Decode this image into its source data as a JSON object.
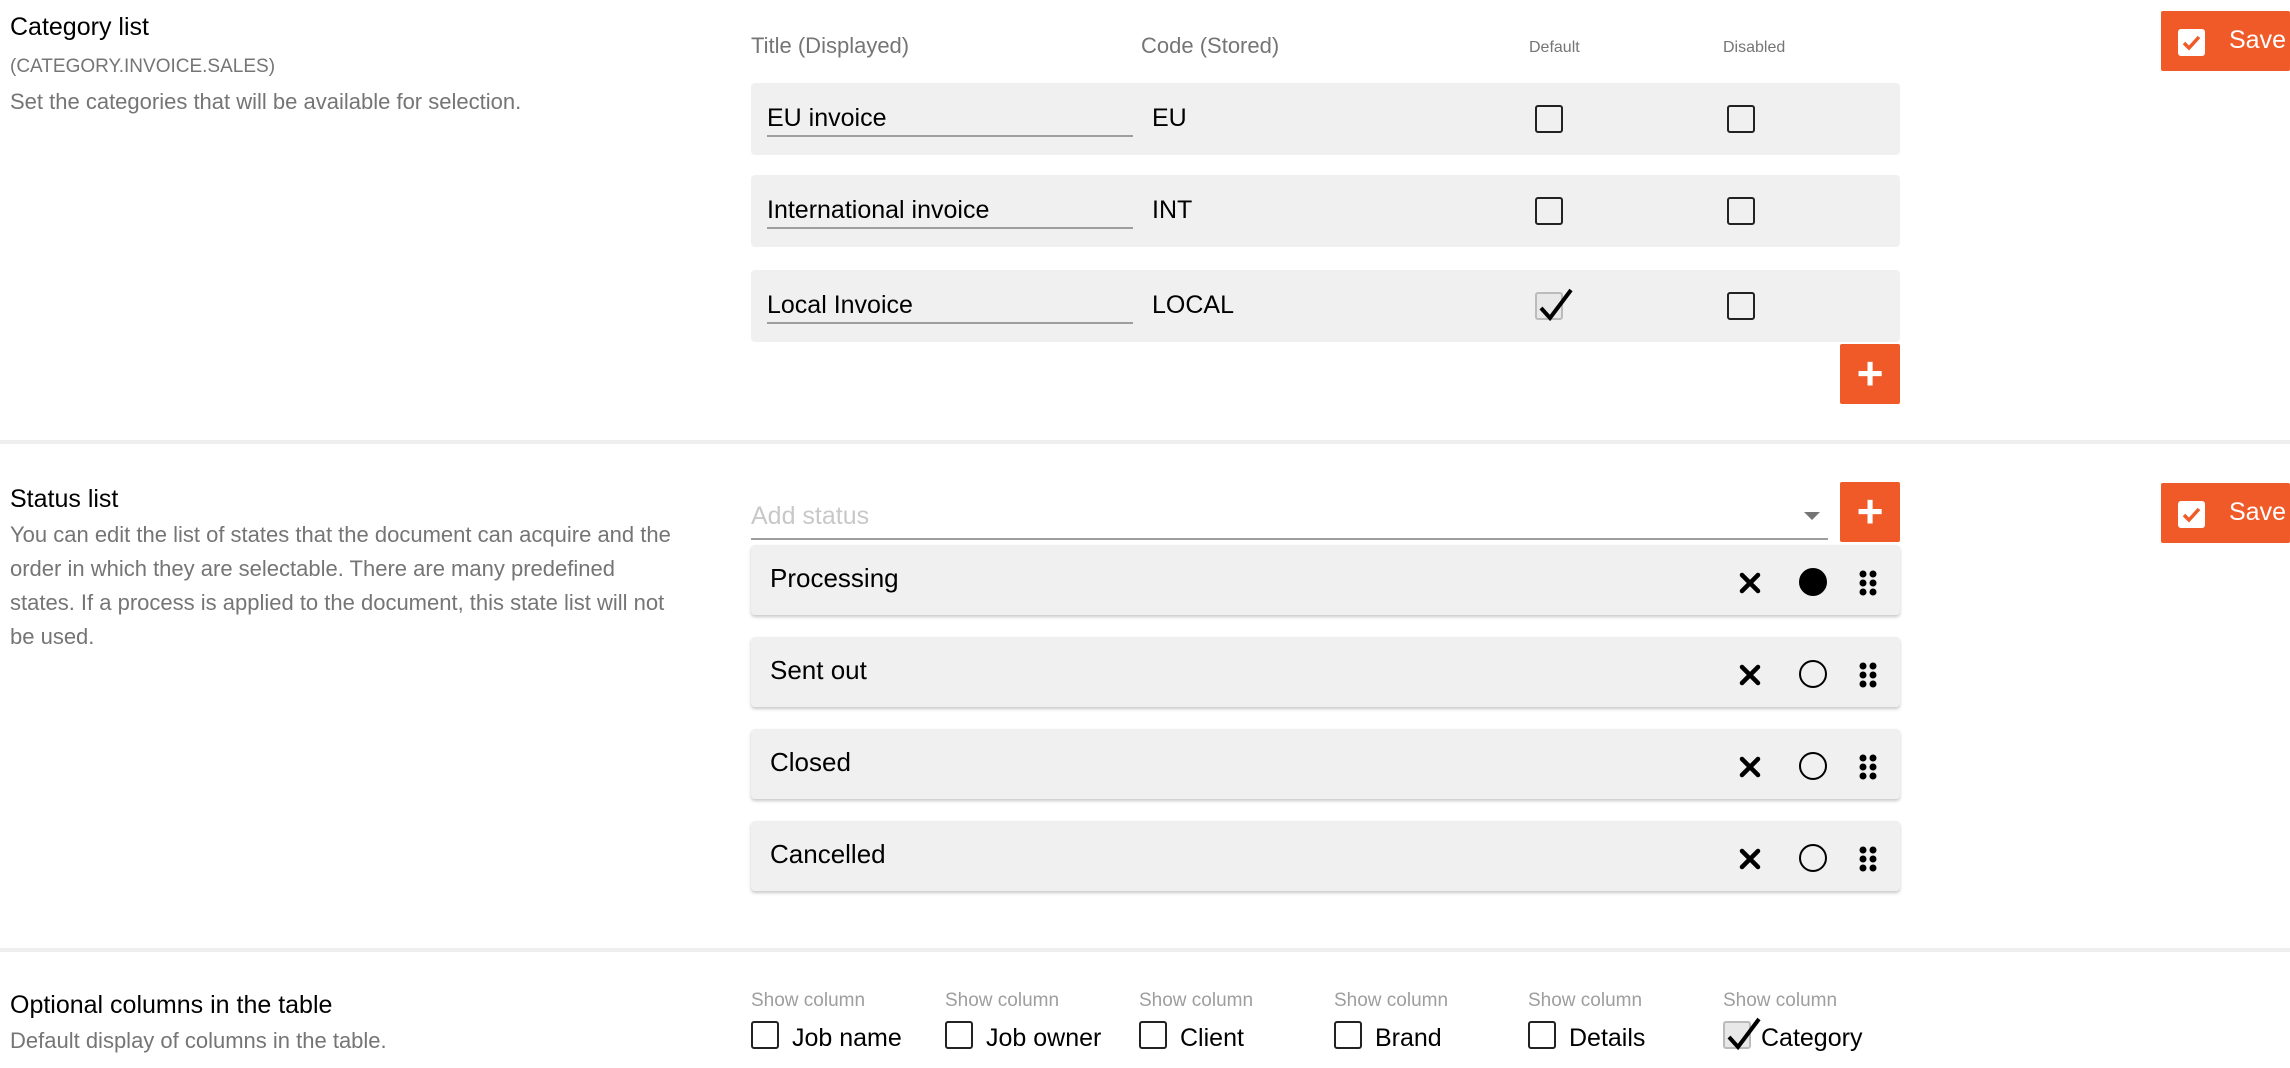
{
  "category_section": {
    "title": "Category list",
    "code": "(CATEGORY.INVOICE.SALES)",
    "description": "Set the categories that will be available for selection.",
    "headers": {
      "title": "Title (Displayed)",
      "code": "Code (Stored)",
      "default": "Default",
      "disabled": "Disabled"
    },
    "rows": [
      {
        "title": "EU invoice",
        "code": "EU",
        "default": false,
        "disabled": false
      },
      {
        "title": "International invoice",
        "code": "INT",
        "default": false,
        "disabled": false
      },
      {
        "title": "Local Invoice",
        "code": "LOCAL",
        "default": true,
        "disabled": false
      }
    ],
    "add_label": "+",
    "save_label": "Save"
  },
  "status_section": {
    "title": "Status list",
    "description": "You can edit the list of states that the document can acquire and the order in which they are selectable. There are many predefined states. If a process is applied to the document, this state list will not be used.",
    "add_placeholder": "Add status",
    "add_label": "+",
    "save_label": "Save",
    "statuses": [
      {
        "label": "Processing",
        "selected": true
      },
      {
        "label": "Sent out",
        "selected": false
      },
      {
        "label": "Closed",
        "selected": false
      },
      {
        "label": "Cancelled",
        "selected": false
      }
    ]
  },
  "optional_columns_section": {
    "title": "Optional columns in the table",
    "description": "Default display of columns in the table.",
    "columns": [
      {
        "head": "Show column",
        "label": "Job name",
        "checked": false
      },
      {
        "head": "Show column",
        "label": "Job owner",
        "checked": false
      },
      {
        "head": "Show column",
        "label": "Client",
        "checked": false
      },
      {
        "head": "Show column",
        "label": "Brand",
        "checked": false
      },
      {
        "head": "Show column",
        "label": "Details",
        "checked": false
      },
      {
        "head": "Show column",
        "label": "Category",
        "checked": true
      }
    ]
  },
  "colors": {
    "accent": "#f05a28",
    "row_bg": "#f0f0f0",
    "muted_text": "#757575"
  },
  "icons": {
    "save": "check-square-icon",
    "add": "plus-icon",
    "remove": "close-x-icon",
    "select": "radio-icon",
    "reorder": "drag-handle-icon",
    "dropdown": "caret-down-icon"
  }
}
